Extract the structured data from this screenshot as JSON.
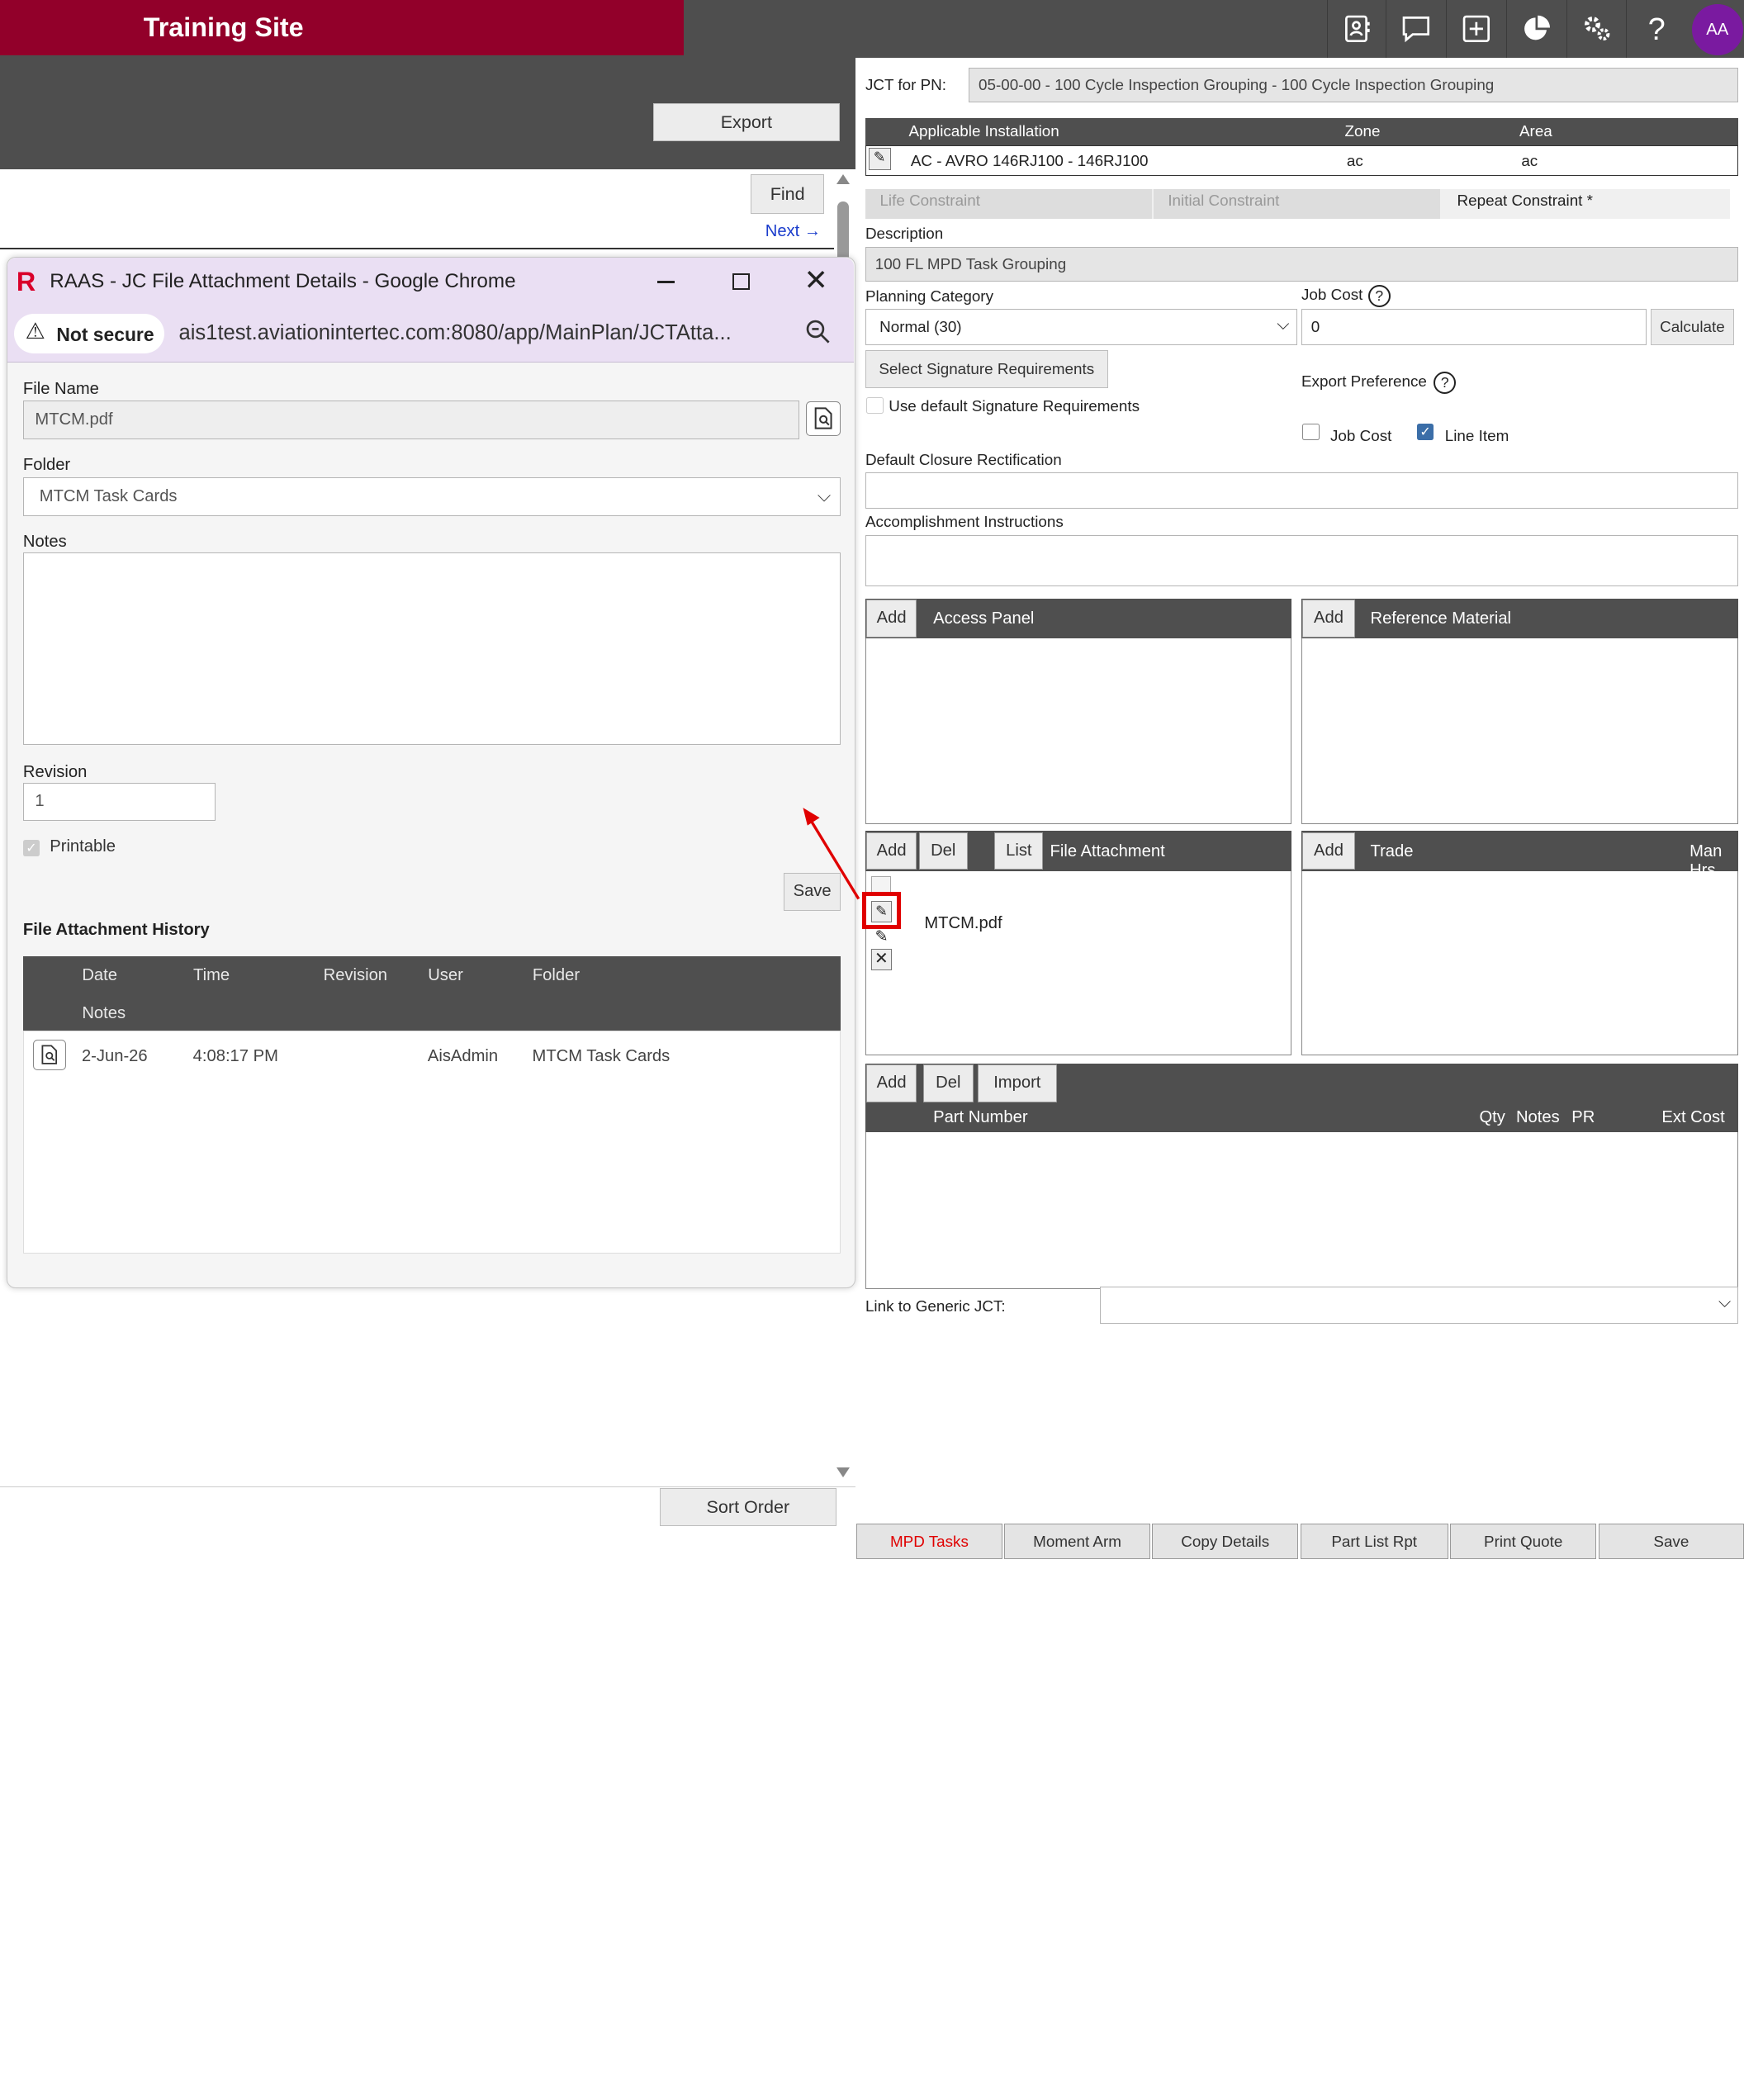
{
  "app": {
    "site_title": "Training Site",
    "avatar": "AA"
  },
  "topbar_icons": [
    "contact-card-icon",
    "chat-icon",
    "add-icon",
    "pie-chart-icon",
    "gears-icon",
    "help-icon"
  ],
  "left": {
    "export_label": "Export",
    "find_label": "Find",
    "next_label": "Next →",
    "sort_order_label": "Sort Order"
  },
  "dialog": {
    "window_title": "RAAS - JC File Attachment Details - Google Chrome",
    "not_secure": "Not secure",
    "url": "ais1test.aviationintertec.com:8080/app/MainPlan/JCTAtta...",
    "file_name_label": "File Name",
    "file_name": "MTCM.pdf",
    "folder_label": "Folder",
    "folder": "MTCM Task Cards",
    "notes_label": "Notes",
    "notes": "",
    "revision_label": "Revision",
    "revision": "1",
    "printable_label": "Printable",
    "save_label": "Save",
    "history_title": "File Attachment History",
    "history_cols": [
      "Date",
      "Time",
      "Revision",
      "User",
      "Folder"
    ],
    "history_cols2": [
      "Notes"
    ],
    "history_rows": [
      {
        "date": "2-Jun-26",
        "time": "4:08:17 PM",
        "revision": "",
        "user": "AisAdmin",
        "folder": "MTCM Task Cards"
      }
    ]
  },
  "right": {
    "jct_pn_label": "JCT for PN:",
    "jct_pn": "05-00-00 - 100 Cycle Inspection Grouping - 100 Cycle Inspection Grouping",
    "install_cols": [
      "Applicable Installation",
      "Zone",
      "Area"
    ],
    "install_row": {
      "installation": "AC - AVRO 146RJ100 - 146RJ100",
      "zone": "ac",
      "area": "ac"
    },
    "tabs": [
      "Life Constraint",
      "Initial Constraint",
      "Repeat Constraint *"
    ],
    "description_label": "Description",
    "description": "100 FL MPD Task Grouping",
    "planning_label": "Planning Category",
    "planning": "Normal (30)",
    "job_cost_label": "Job Cost",
    "job_cost": "0",
    "calculate_label": "Calculate",
    "sig_req_label": "Select Signature Requirements",
    "use_default_sig": "Use default Signature Requirements",
    "export_pref_label": "Export Preference",
    "export_job_cost": "Job Cost",
    "export_line_item": "Line Item",
    "default_closure_label": "Default Closure Rectification",
    "accomplishment_label": "Accomplishment Instructions",
    "access_panel": "Access Panel",
    "reference_material": "Reference Material",
    "file_attachment": "File Attachment",
    "attachment_file": "MTCM.pdf",
    "trade": "Trade",
    "man_hrs": "Man Hrs",
    "part_number": "Part Number",
    "qty": "Qty",
    "notes": "Notes",
    "pr": "PR",
    "ext_cost": "Ext Cost",
    "add": "Add",
    "del": "Del",
    "list": "List",
    "import": "Import",
    "link_generic_label": "Link to Generic JCT:",
    "bottom_tabs": [
      "MPD Tasks",
      "Moment Arm",
      "Copy Details",
      "Part List Rpt",
      "Print Quote",
      "Save"
    ]
  }
}
